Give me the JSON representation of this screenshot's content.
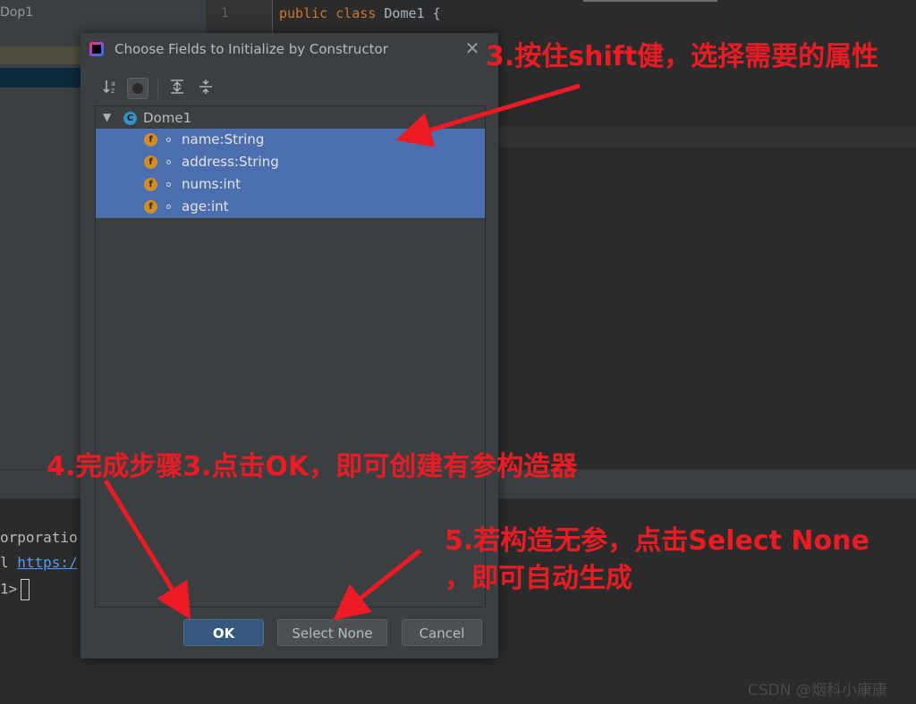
{
  "ide": {
    "project_title": "Dop1",
    "line_number": "1",
    "code": {
      "kw1": "public",
      "kw2": "class",
      "class_name": "Dome1",
      "brace": "{"
    },
    "terminal": {
      "line1": "orporatio",
      "line2_prefix": "l ",
      "line2_link": "https:/",
      "line3_prompt": "1>"
    }
  },
  "dialog": {
    "title": "Choose Fields to Initialize by Constructor",
    "close_icon": "close-icon",
    "toolbar": [
      "sort-alphabetically-icon",
      "show-classes-icon",
      "expand-all-icon",
      "collapse-all-icon"
    ],
    "tree": {
      "root": {
        "icon_letter": "C",
        "label": "Dome1",
        "expanded": true
      },
      "fields": [
        {
          "icon_letter": "f",
          "label": "name:String",
          "selected": true
        },
        {
          "icon_letter": "f",
          "label": "address:String",
          "selected": true
        },
        {
          "icon_letter": "f",
          "label": "nums:int",
          "selected": true
        },
        {
          "icon_letter": "f",
          "label": "age:int",
          "selected": true
        }
      ]
    },
    "buttons": {
      "ok": "OK",
      "select_none": "Select None",
      "cancel": "Cancel"
    }
  },
  "annotations": {
    "step3": "3.按住shift健，选择需要的属性",
    "step4": "4.完成步骤3.点击OK，即可创建有参构造器",
    "step5_line1": "5.若构造无参，点击Select None",
    "step5_line2": "，即可自动生成"
  },
  "watermark": "CSDN @烟科小康康",
  "colors": {
    "annotation": "#ed1c24",
    "selection": "#4b6eaf",
    "ok_button": "#365880",
    "dialog_bg": "#3c3f41"
  }
}
